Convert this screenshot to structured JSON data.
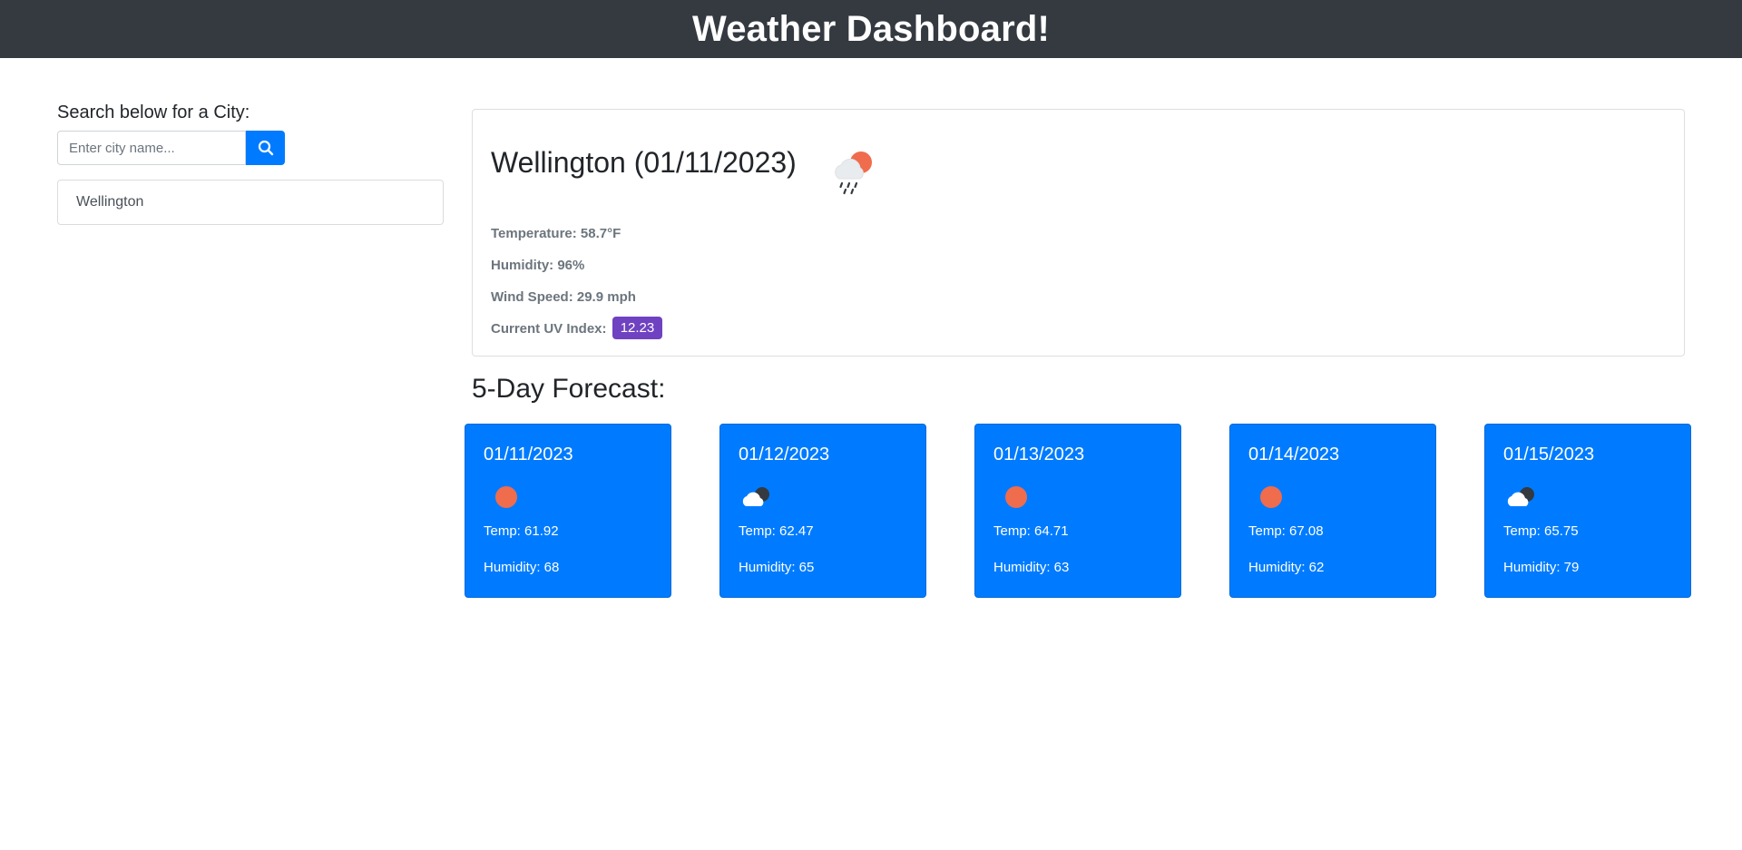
{
  "header": {
    "title": "Weather Dashboard!"
  },
  "search": {
    "label": "Search below for a City:",
    "placeholder": "Enter city name...",
    "value": ""
  },
  "history": [
    {
      "city": "Wellington"
    }
  ],
  "current": {
    "title": "Wellington (01/11/2023)",
    "icon": "rain-sun-icon",
    "temperature": "Temperature: 58.7°F",
    "humidity": "Humidity: 96%",
    "wind": "Wind Speed: 29.9 mph",
    "uv_label": "Current UV Index:",
    "uv_value": "12.23",
    "uv_color": "#6f42c1"
  },
  "forecast": {
    "title": "5-Day Forecast:",
    "accent": "#007bff",
    "days": [
      {
        "date": "01/11/2023",
        "icon": "sun-icon",
        "temp": "Temp: 61.92",
        "humidity": "Humidity: 68"
      },
      {
        "date": "01/12/2023",
        "icon": "cloud-night-icon",
        "temp": "Temp: 62.47",
        "humidity": "Humidity: 65"
      },
      {
        "date": "01/13/2023",
        "icon": "sun-icon",
        "temp": "Temp: 64.71",
        "humidity": "Humidity: 63"
      },
      {
        "date": "01/14/2023",
        "icon": "sun-icon",
        "temp": "Temp: 67.08",
        "humidity": "Humidity: 62"
      },
      {
        "date": "01/15/2023",
        "icon": "cloud-night-icon",
        "temp": "Temp: 65.75",
        "humidity": "Humidity: 79"
      }
    ]
  }
}
